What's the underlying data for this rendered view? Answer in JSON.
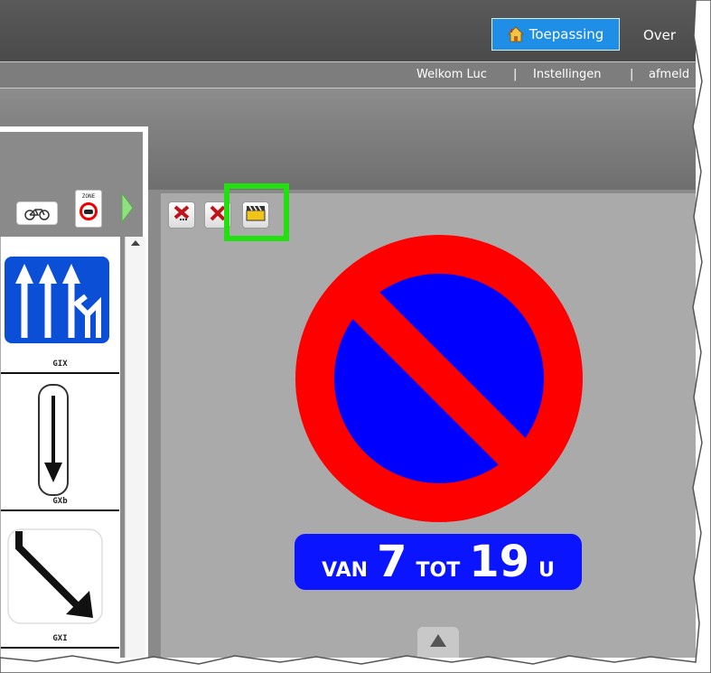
{
  "header": {
    "app_button_label": "Toepassing",
    "about_label": "Over"
  },
  "userbar": {
    "welcome": "Welkom Luc",
    "separator": "|",
    "settings": "Instellingen",
    "logout": "afmeld"
  },
  "sign_library": {
    "toolbar_icons": [
      "bicycle-icon",
      "zone-sign-icon",
      "next-arrow-icon"
    ],
    "zone_icon_text": "ZONE",
    "items": [
      {
        "code": "GIX"
      },
      {
        "code": "GXb"
      },
      {
        "code": "GXI"
      }
    ]
  },
  "editor": {
    "tools": [
      "delete-all-icon",
      "delete-icon",
      "film-clapper-icon"
    ],
    "highlighted_tool": "film-clapper-icon",
    "sign": {
      "type": "no-parking",
      "colors": {
        "ring": "#ff0000",
        "field": "#0000ff"
      }
    },
    "plate": {
      "prefix": "VAN",
      "from": "7",
      "mid": "TOT",
      "to": "19",
      "suffix": "U",
      "color": "#0a14ff"
    }
  },
  "colors": {
    "accent": "#1e8ee6",
    "highlight": "#22e010"
  }
}
